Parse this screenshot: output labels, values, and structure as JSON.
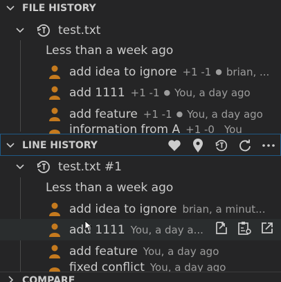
{
  "file_history": {
    "title": "FILE HISTORY",
    "file_name": "test.txt",
    "group_label": "Less than a week ago",
    "commits": [
      {
        "message": "add idea to ignore",
        "changes": "+1 -1",
        "author_time": "brian, ..."
      },
      {
        "message": "add 1111",
        "changes": "+1 -1",
        "author_time": "You, a day ago"
      },
      {
        "message": "add feature",
        "changes": "+1 -1",
        "author_time": "You, a day ago"
      },
      {
        "message": "information from A",
        "changes": "+1 -0",
        "author_time": "You"
      }
    ]
  },
  "line_history": {
    "title": "LINE HISTORY",
    "file_name": "test.txt #1",
    "group_label": "Less than a week ago",
    "commits": [
      {
        "message": "add idea to ignore",
        "author_time": "brian, a minut..."
      },
      {
        "message": "add 1111",
        "author_time": "You, a day a..."
      },
      {
        "message": "add feature",
        "author_time": "You, a day ago"
      },
      {
        "message": "fixed conflict",
        "author_time": "You, a day ago"
      }
    ]
  },
  "compare": {
    "title": "COMPARE"
  },
  "icons": {
    "chevron": "chevron-down-icon",
    "file_history": "history-icon",
    "avatar": "user-avatar-icon",
    "heart": "heart-icon",
    "pin": "location-pin-icon",
    "history": "history-icon",
    "refresh": "refresh-icon",
    "more": "more-icon",
    "open_file": "open-file-icon",
    "compare_changes": "compare-changes-icon",
    "open_external": "open-external-icon"
  },
  "colors": {
    "background": "#252526",
    "hover_background": "#2a2d2e",
    "focus_border": "#1f5a86",
    "text": "#cccccc",
    "description": "#9d9d9d",
    "avatar": "#c57a1e"
  }
}
